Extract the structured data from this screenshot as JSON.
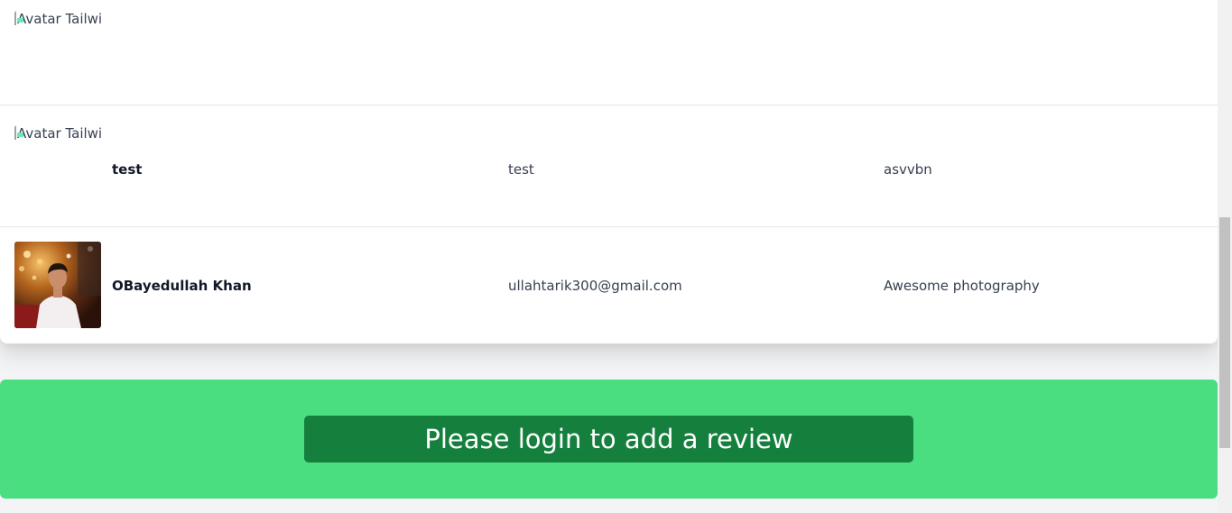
{
  "reviews": [
    {
      "avatar_alt": "Avatar Tailwind CSS Component",
      "avatar_type": "broken",
      "name": "",
      "email": "",
      "review": ""
    },
    {
      "avatar_alt": "Avatar Tailwind CSS Component",
      "avatar_type": "broken",
      "name": "test",
      "email": "test",
      "review": "asvvbn"
    },
    {
      "avatar_alt": "",
      "avatar_type": "photo",
      "name": "OBayedullah Khan",
      "email": "ullahtarik300@gmail.com",
      "review": "Awesome photography"
    }
  ],
  "login_banner": {
    "button_label": "Please login to add a review",
    "banner_color": "#4ade80",
    "button_color": "#15803d"
  }
}
